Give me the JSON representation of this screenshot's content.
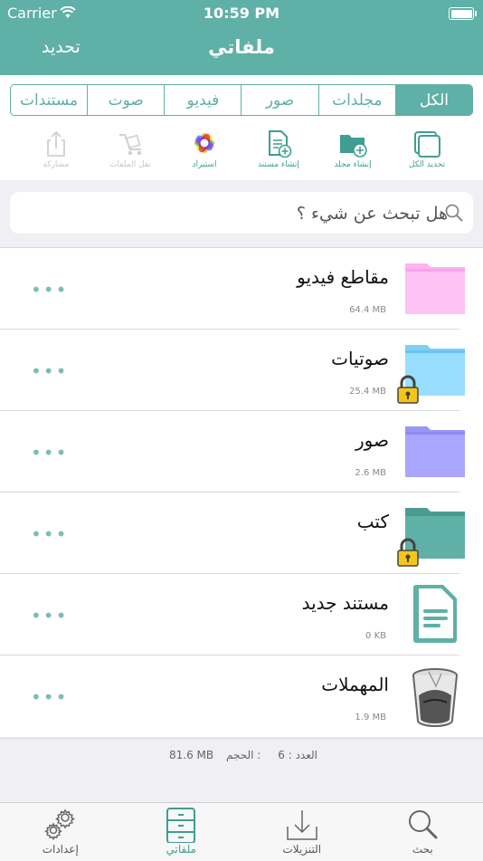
{
  "status_bar": {
    "carrier": "Carrier",
    "time": "10:59 PM"
  },
  "nav": {
    "title": "ملفاتي",
    "left_button": "تحديد"
  },
  "segments": [
    {
      "label": "الكل",
      "active": true
    },
    {
      "label": "مجلدات",
      "active": false
    },
    {
      "label": "صور",
      "active": false
    },
    {
      "label": "فيديو",
      "active": false
    },
    {
      "label": "صوت",
      "active": false
    },
    {
      "label": "مستندات",
      "active": false
    }
  ],
  "actions": [
    {
      "label": "تحديد الكل",
      "icon": "select-all-icon",
      "enabled": true
    },
    {
      "label": "إنشاء مجلد",
      "icon": "new-folder-icon",
      "enabled": true
    },
    {
      "label": "إنشاء مستند",
      "icon": "new-document-icon",
      "enabled": true
    },
    {
      "label": "استيراد",
      "icon": "photos-import-icon",
      "enabled": true
    },
    {
      "label": "نقل الملفات",
      "icon": "move-files-icon",
      "enabled": false
    },
    {
      "label": "مشاركة",
      "icon": "share-icon",
      "enabled": false
    }
  ],
  "search": {
    "placeholder": "هل تبحث عن شيء ؟"
  },
  "items": [
    {
      "name": "مقاطع فيديو",
      "size": "64.4 MB",
      "icon": "folder-icon",
      "color": "#ffb3f2",
      "locked": false
    },
    {
      "name": "صوتيات",
      "size": "25.4 MB",
      "icon": "folder-icon",
      "color": "#99ddff",
      "locked": true
    },
    {
      "name": "صور",
      "size": "2.6 MB",
      "icon": "folder-icon",
      "color": "#a8a6ff",
      "locked": false
    },
    {
      "name": "كتب",
      "size": "",
      "icon": "folder-icon",
      "color": "#5fb0a6",
      "locked": true
    },
    {
      "name": "مستند جديد",
      "size": "0 KB",
      "icon": "document-icon",
      "color": "#5fb0a6",
      "locked": false
    },
    {
      "name": "المهملات",
      "size": "1.9 MB",
      "icon": "trash-icon",
      "color": "#777777",
      "locked": false
    }
  ],
  "footer": {
    "count_text": "العدد : 6",
    "size_label": "الحجم :",
    "size_value": "81.6 MB"
  },
  "tabs": [
    {
      "label": "إعدادات",
      "icon": "gear-icon",
      "active": false
    },
    {
      "label": "ملفاتي",
      "icon": "cabinet-icon",
      "active": true
    },
    {
      "label": "التنزيلات",
      "icon": "download-icon",
      "active": false
    },
    {
      "label": "بحث",
      "icon": "search-icon",
      "active": false
    }
  ],
  "colors": {
    "accent": "#5fb0a6",
    "background": "#efeff4"
  }
}
